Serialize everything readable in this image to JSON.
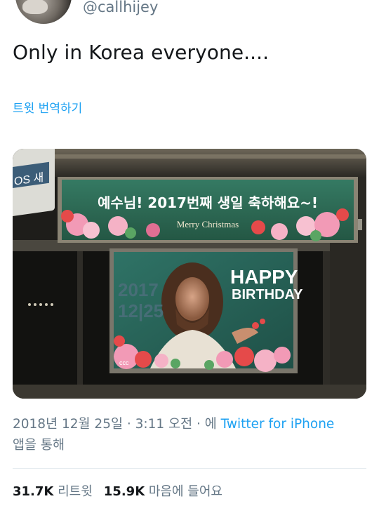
{
  "author": {
    "handle": "@callhijey"
  },
  "tweet": {
    "text": "Only in Korea everyone....",
    "translate_label": "트윗 번역하기"
  },
  "media": {
    "banner_text": "예수님! 2017번째 생일 축하해요~!",
    "banner_subtext": "Merry Christmas",
    "poster_date_year": "2017",
    "poster_date_day": "12|25",
    "poster_happy": "HAPPY",
    "poster_birthday": "BIRTHDAY",
    "poster_logo": "ccc",
    "station_sign": "OS 새"
  },
  "meta": {
    "timestamp": "2018년 12월 25일 · 3:11 오전 · 에",
    "source": "Twitter for iPhone",
    "source_suffix": "앱을 통해"
  },
  "stats": {
    "retweets_count": "31.7K",
    "retweets_label": "리트윗",
    "likes_count": "15.9K",
    "likes_label": "마음에 들어요"
  },
  "colors": {
    "link": "#1da1f2",
    "secondary_text": "#657786",
    "primary_text": "#14171a",
    "banner_green": "#2f6f5a",
    "poster_teal": "#2d6d63"
  }
}
